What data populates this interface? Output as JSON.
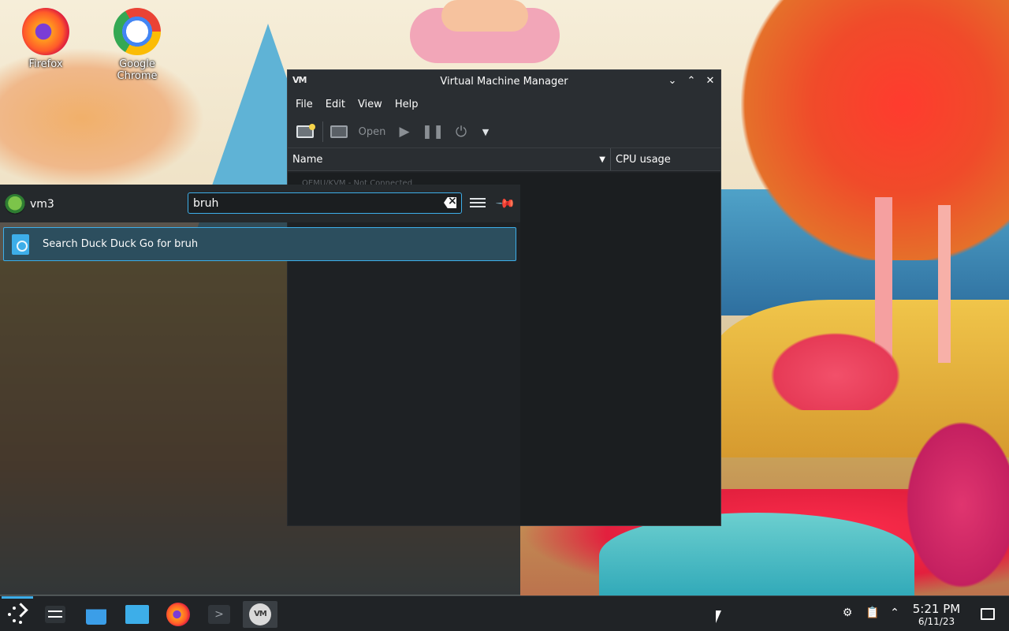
{
  "desktop": {
    "icons": [
      {
        "label": "Firefox",
        "icon": "firefox-icon"
      },
      {
        "label": "Google Chrome",
        "icon": "chrome-icon"
      }
    ]
  },
  "vmm": {
    "title": "Virtual Machine Manager",
    "logo": "VM",
    "menu": [
      "File",
      "Edit",
      "View",
      "Help"
    ],
    "toolbar": {
      "open_label": "Open"
    },
    "columns": {
      "name": "Name",
      "cpu": "CPU usage"
    },
    "rows": [
      {
        "text": "QEMU/KVM - Not Connected"
      }
    ]
  },
  "krunner": {
    "user": "vm3",
    "query": "bruh",
    "results": [
      {
        "label": "Search Duck Duck Go for bruh",
        "icon": "globe-document-icon"
      }
    ]
  },
  "taskbar": {
    "clock_time": "5:21 PM",
    "clock_date": "6/11/23",
    "vm_label": "VM",
    "term_glyph": ">"
  },
  "colors": {
    "accent": "#3daee9",
    "panel": "#202326",
    "highlight": "#2c4e5e"
  }
}
